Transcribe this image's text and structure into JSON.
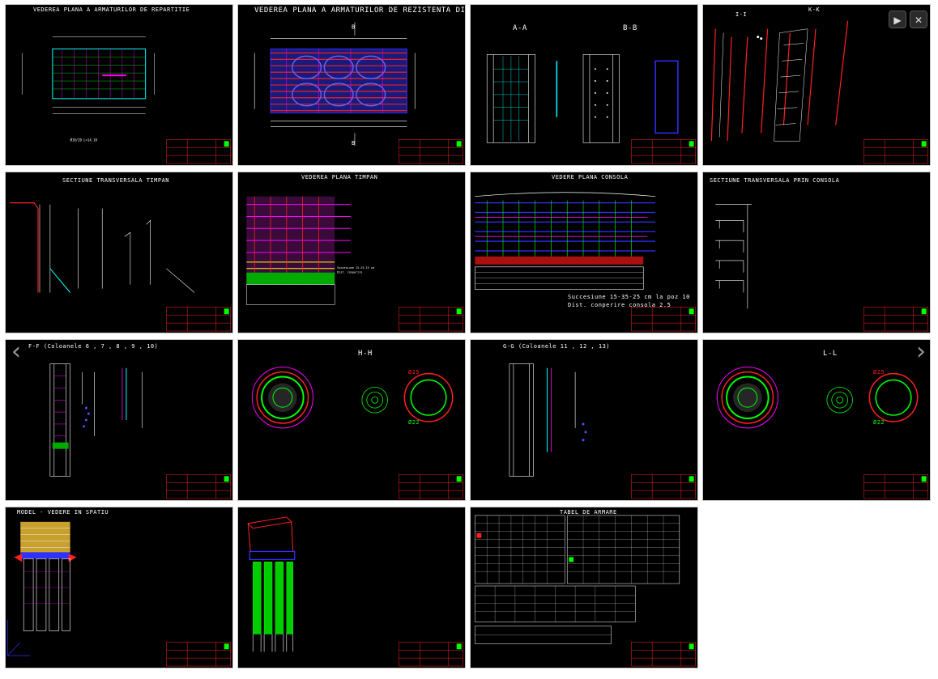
{
  "controls": {
    "play_label": "▶",
    "close_label": "✕",
    "prev_label": "‹",
    "next_label": "›"
  },
  "tiles": [
    {
      "title": "VEDEREA PLANA A ARMATURILOR DE REPARTITIE"
    },
    {
      "title": "VEDEREA PLANA A ARMATURILOR DE REZISTENTA DIN RADIER"
    },
    {
      "title_a": "A-A",
      "title_b": "B-B"
    },
    {
      "title_a": "I-I",
      "title_b": "K-K"
    },
    {
      "title": "SECTIUNE TRANSVERSALA TIMPAN"
    },
    {
      "title": "VEDEREA PLANA TIMPAN"
    },
    {
      "title": "VEDERE PLANA CONSOLA",
      "note_1": "Succesiune 15-35-25 cm la poz 10",
      "note_2": "Dist. conperire consola 2.5"
    },
    {
      "title": "SECTIUNE TRANSVERSALA PRIN CONSOLA"
    },
    {
      "title": "F-F (Coloanele 6 , 7 , 8 , 9 , 10)"
    },
    {
      "title": "H-H",
      "label_1": "Ø25",
      "label_2": "Ø22"
    },
    {
      "title": "G-G (Coloanele 11 , 12 , 13)"
    },
    {
      "title": "L-L",
      "label_1": "Ø25",
      "label_2": "Ø22"
    },
    {
      "title": "MODEL - VEDERE IN SPATIU"
    },
    {
      "title": ""
    },
    {
      "title": "TABEL DE ARMARE"
    }
  ],
  "colors": {
    "background": "#ffffff",
    "tile_bg": "#000000",
    "border": "#c8c8c8",
    "red": "#ff2020",
    "blue": "#3030ff",
    "cyan": "#00ffff",
    "green": "#00ff00",
    "magenta": "#ff00ff",
    "yellow": "#ffff00"
  }
}
